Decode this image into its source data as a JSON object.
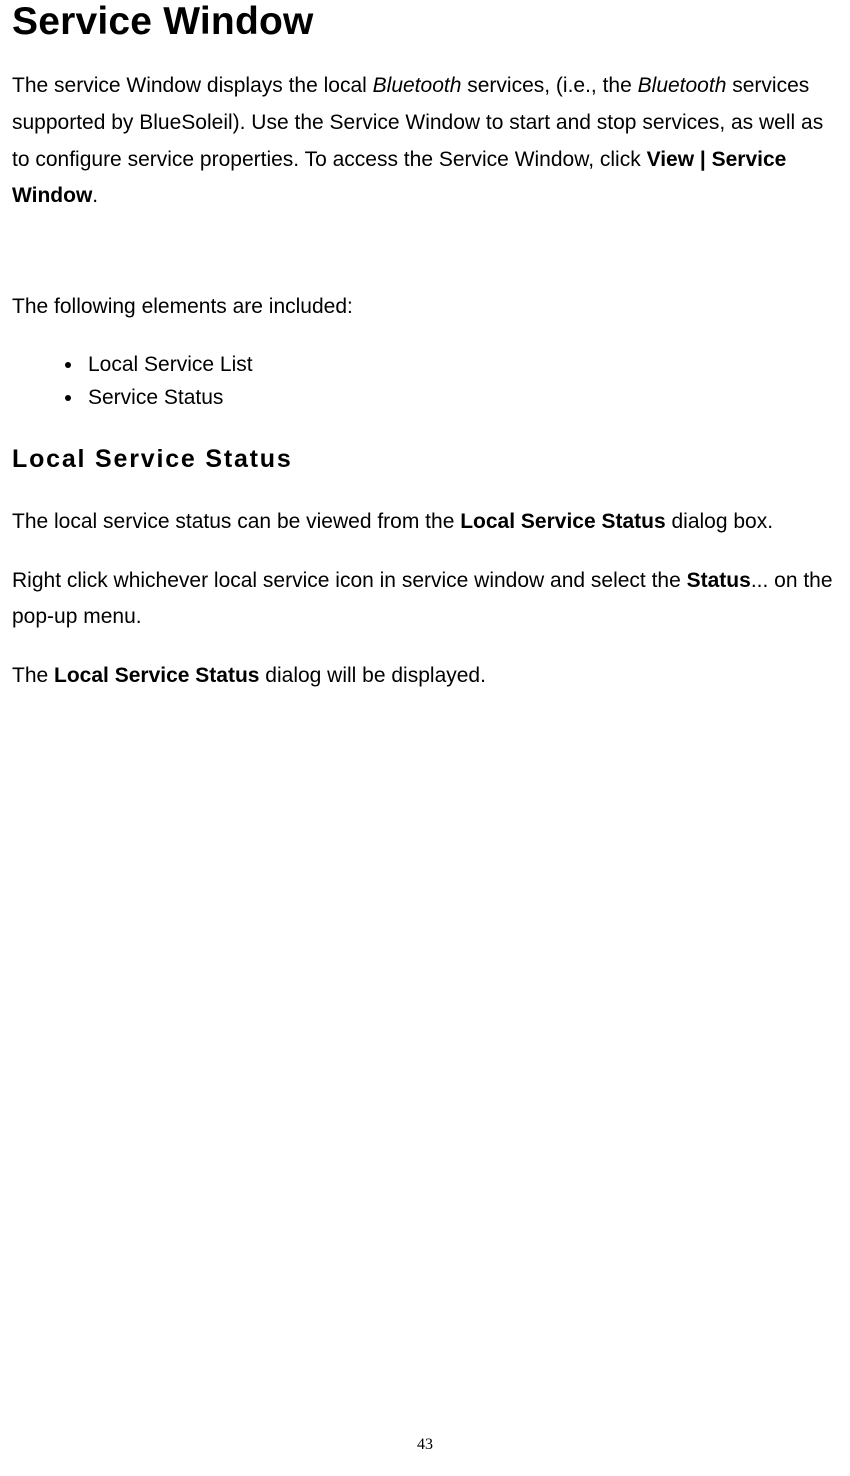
{
  "heading": "Service Window",
  "intro": {
    "t1": "The service Window displays the local ",
    "em1": "Bluetooth",
    "t2": " services, (i.e., the ",
    "em2": "Bluetooth",
    "t3": " services supported by BlueSoleil). Use the Service Window to start and stop services, as well as to configure service properties. To access the Service Window, click ",
    "b1": "View | Service Window",
    "t4": "."
  },
  "lead": "The following elements are included:",
  "items": {
    "0": "Local Service List",
    "1": "Service Status"
  },
  "subheading": "Local Service Status",
  "p3": {
    "t1": "The local service status can be viewed from the ",
    "b1": "Local Service Status",
    "t2": " dialog box."
  },
  "p4": {
    "t1": "Right click whichever local service icon in service window and select the ",
    "b1": "Status",
    "t2": "... on the pop-up menu."
  },
  "p5": {
    "t1": "The ",
    "b1": "Local Service Status",
    "t2": " dialog will be displayed."
  },
  "pageNumber": "43"
}
